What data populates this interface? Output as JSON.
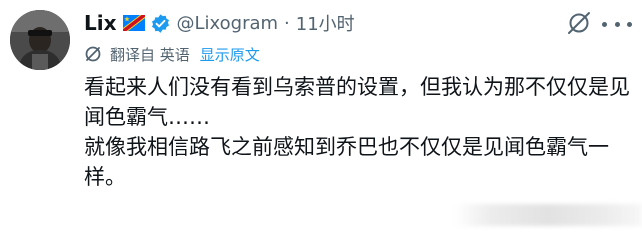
{
  "tweet": {
    "author_name": "Lix",
    "handle": "@Lixogram",
    "separator": "·",
    "time": "11小时",
    "translated_label": "翻译自 英语",
    "show_original": "显示原文",
    "paragraphs": [
      "看起来人们没有看到乌索普的设置，但我认为那不仅仅是见闻色霸气……",
      "就像我相信路飞之前感知到乔巴也不仅仅是见闻色霸气一样。"
    ]
  },
  "icons": {
    "flag": "dr-congo-flag-icon",
    "verified": "verified-badge-icon",
    "grok": "grok-icon",
    "more": "more-icon",
    "translate": "translate-icon"
  },
  "colors": {
    "text": "#0f1419",
    "secondary": "#536471",
    "link": "#1d9bf0",
    "verified": "#1d9bf0"
  }
}
